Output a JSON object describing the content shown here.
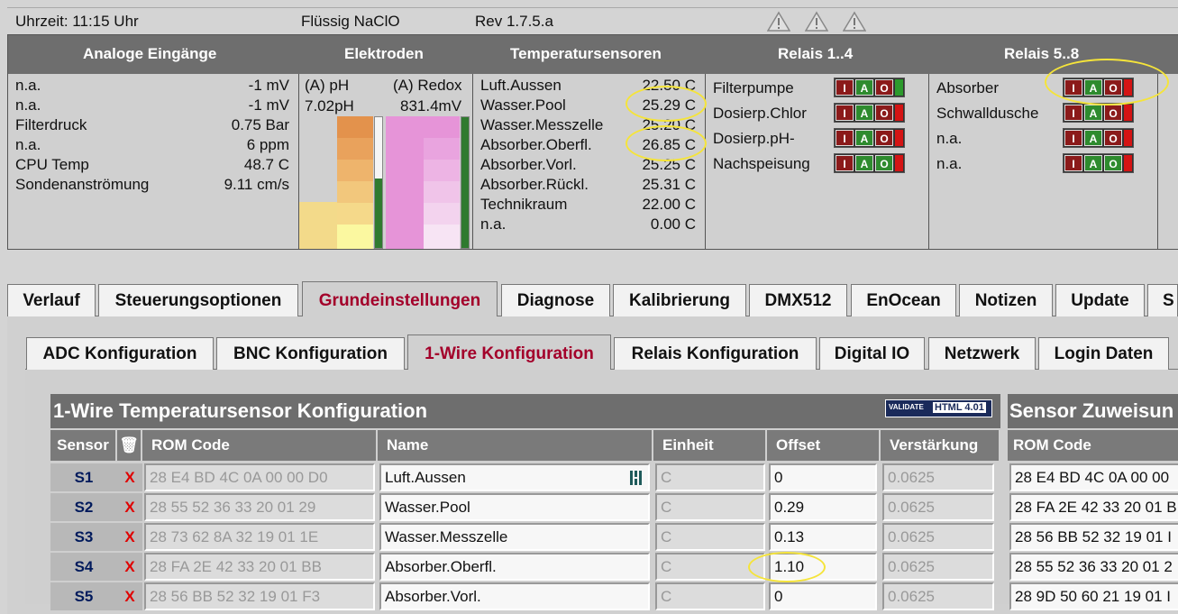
{
  "status": {
    "time": "Uhrzeit: 11:15 Uhr",
    "product": "Flüssig NaClO",
    "rev": "Rev 1.7.5.a"
  },
  "dash": {
    "headers": [
      "Analoge Eingänge",
      "Elektroden",
      "Temperatursensoren",
      "Relais 1..4",
      "Relais 5..8"
    ],
    "analog": [
      {
        "l": "n.a.",
        "r": "-1 mV"
      },
      {
        "l": "n.a.",
        "r": "-1 mV"
      },
      {
        "l": "Filterdruck",
        "r": "0.75 Bar"
      },
      {
        "l": "n.a.",
        "r": "6 ppm"
      },
      {
        "l": "CPU Temp",
        "r": "48.7 C"
      },
      {
        "l": "Sondenanströmung",
        "r": "9.11 cm/s"
      }
    ],
    "electrodes": {
      "ph_label": "(A) pH",
      "ph_value": "7.02pH",
      "redox_label": "(A) Redox",
      "redox_value": "831.4mV"
    },
    "temps": [
      {
        "l": "Luft.Aussen",
        "r": "22.50 C"
      },
      {
        "l": "Wasser.Pool",
        "r": "25.29 C"
      },
      {
        "l": "Wasser.Messzelle",
        "r": "25.20 C"
      },
      {
        "l": "Absorber.Oberfl.",
        "r": "26.85 C"
      },
      {
        "l": "Absorber.Vorl.",
        "r": "25.25 C"
      },
      {
        "l": "Absorber.Rückl.",
        "r": "25.31 C"
      },
      {
        "l": "Technikraum",
        "r": "22.00 C"
      },
      {
        "l": "n.a.",
        "r": "0.00 C"
      }
    ],
    "relays14": [
      "Filterpumpe",
      "Dosierp.Chlor",
      "Dosierp.pH-",
      "Nachspeisung"
    ],
    "relays58": [
      "Absorber",
      "Schwalldusche",
      "n.a.",
      "n.a."
    ],
    "relay_buttons": {
      "i": "I",
      "a": "A",
      "o": "O"
    }
  },
  "tabs": [
    "Verlauf",
    "Steuerungsoptionen",
    "Grundeinstellungen",
    "Diagnose",
    "Kalibrierung",
    "DMX512",
    "EnOcean",
    "Notizen",
    "Update",
    "S"
  ],
  "subtabs": [
    "ADC Konfiguration",
    "BNC Konfiguration",
    "1-Wire Konfiguration",
    "Relais Konfiguration",
    "Digital IO",
    "Netzwerk",
    "Login Daten"
  ],
  "table": {
    "title": "1-Wire Temperatursensor Konfiguration",
    "title2": "Sensor Zuweisun",
    "badge": "HTML 4.01",
    "badge_prefix": "VALIDATE",
    "headers": [
      "Sensor",
      "ROM Code",
      "Name",
      "Einheit",
      "Offset",
      "Verstärkung"
    ],
    "header2": "ROM Code",
    "delete_symbol": "X",
    "rows": [
      {
        "sensor": "S1",
        "rom": "28 E4 BD 4C 0A 00 00 D0",
        "name": "Luft.Aussen",
        "unit": "C",
        "offset": "0",
        "gain": "0.0625",
        "rom2": "28 E4 BD 4C 0A 00 00"
      },
      {
        "sensor": "S2",
        "rom": "28 55 52 36 33 20 01 29",
        "name": "Wasser.Pool",
        "unit": "C",
        "offset": "0.29",
        "gain": "0.0625",
        "rom2": "28 FA 2E 42 33 20 01 B"
      },
      {
        "sensor": "S3",
        "rom": "28 73 62 8A 32 19 01 1E",
        "name": "Wasser.Messzelle",
        "unit": "C",
        "offset": "0.13",
        "gain": "0.0625",
        "rom2": "28 56 BB 52 32 19 01 I"
      },
      {
        "sensor": "S4",
        "rom": "28 FA 2E 42 33 20 01 BB",
        "name": "Absorber.Oberfl.",
        "unit": "C",
        "offset": "1.10",
        "gain": "0.0625",
        "rom2": "28 55 52 36 33 20 01 2"
      },
      {
        "sensor": "S5",
        "rom": "28 56 BB 52 32 19 01 F3",
        "name": "Absorber.Vorl.",
        "unit": "C",
        "offset": "0",
        "gain": "0.0625",
        "rom2": "28 9D 50 60 21 19 01 I"
      }
    ]
  }
}
